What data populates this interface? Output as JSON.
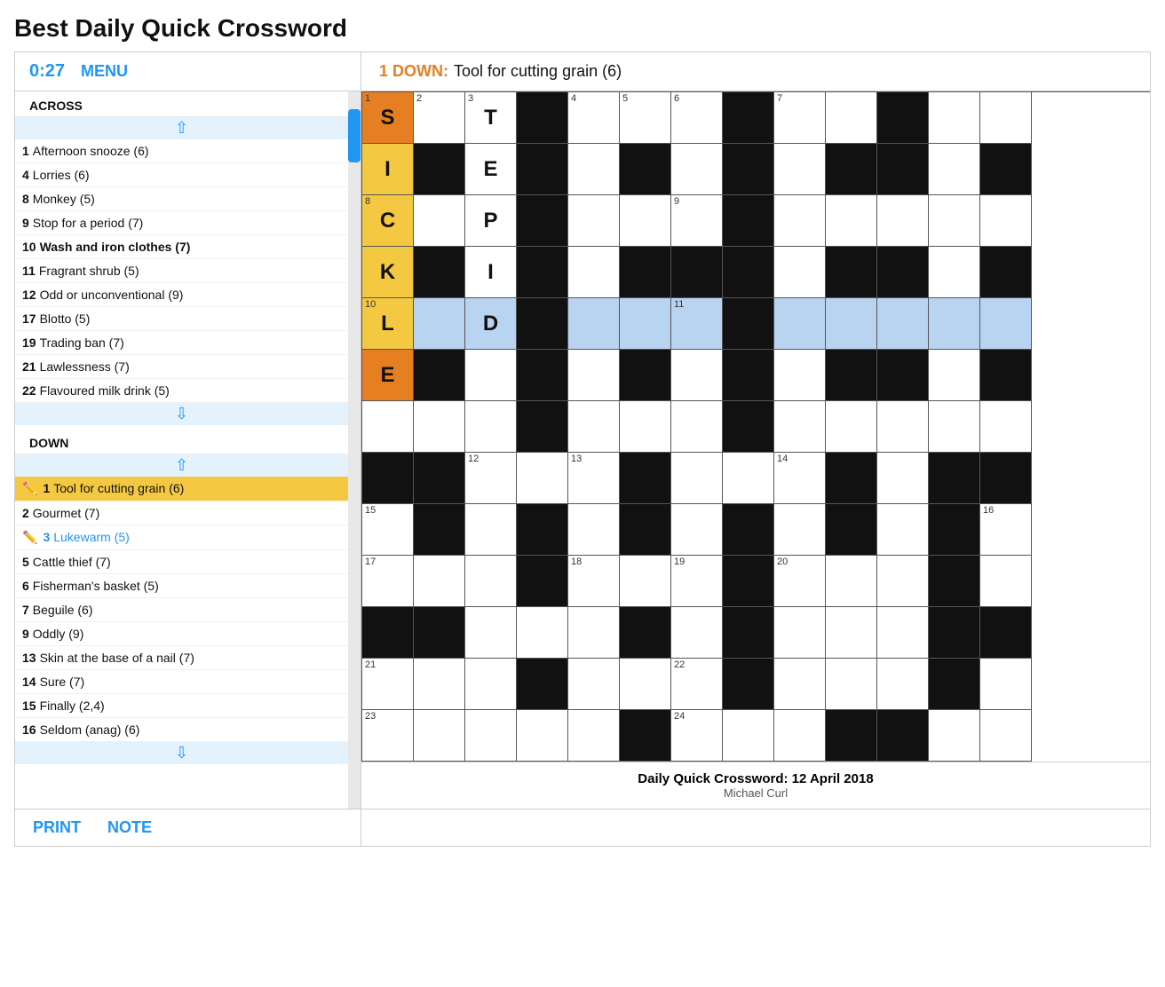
{
  "page": {
    "title": "Best Daily Quick Crossword"
  },
  "header": {
    "timer": "0:27",
    "menu_label": "MENU",
    "active_clue_num": "1 DOWN:",
    "active_clue_text": "Tool for cutting grain (6)"
  },
  "across_clues": {
    "header": "ACROSS",
    "items": [
      {
        "num": "1",
        "text": "Afternoon snooze (6)"
      },
      {
        "num": "4",
        "text": "Lorries (6)"
      },
      {
        "num": "8",
        "text": "Monkey (5)"
      },
      {
        "num": "9",
        "text": "Stop for a period (7)"
      },
      {
        "num": "10",
        "text": "Wash and iron clothes (7)"
      },
      {
        "num": "11",
        "text": "Fragrant shrub (5)"
      },
      {
        "num": "12",
        "text": "Odd or unconventional (9)"
      },
      {
        "num": "17",
        "text": "Blotto (5)"
      },
      {
        "num": "19",
        "text": "Trading ban (7)"
      },
      {
        "num": "21",
        "text": "Lawlessness (7)"
      },
      {
        "num": "22",
        "text": "Flavoured milk drink (5)"
      }
    ]
  },
  "down_clues": {
    "header": "DOWN",
    "items": [
      {
        "num": "1",
        "text": "Tool for cutting grain (6)",
        "highlighted": true,
        "icon": "✏️"
      },
      {
        "num": "2",
        "text": "Gourmet (7)"
      },
      {
        "num": "3",
        "text": "Lukewarm (5)",
        "completed": true,
        "icon": "✏️"
      },
      {
        "num": "5",
        "text": "Cattle thief (7)"
      },
      {
        "num": "6",
        "text": "Fisherman's basket (5)"
      },
      {
        "num": "7",
        "text": "Beguile (6)"
      },
      {
        "num": "9",
        "text": "Oddly (9)"
      },
      {
        "num": "13",
        "text": "Skin at the base of a nail (7)"
      },
      {
        "num": "14",
        "text": "Sure (7)"
      },
      {
        "num": "15",
        "text": "Finally (2,4)"
      },
      {
        "num": "16",
        "text": "Seldom (anag) (6)"
      }
    ]
  },
  "footer": {
    "print_label": "PRINT",
    "note_label": "NOTE",
    "crossword_title": "Daily Quick Crossword: 12 April 2018",
    "author": "Michael Curl"
  },
  "grid": {
    "cols": 13,
    "rows": 13
  }
}
